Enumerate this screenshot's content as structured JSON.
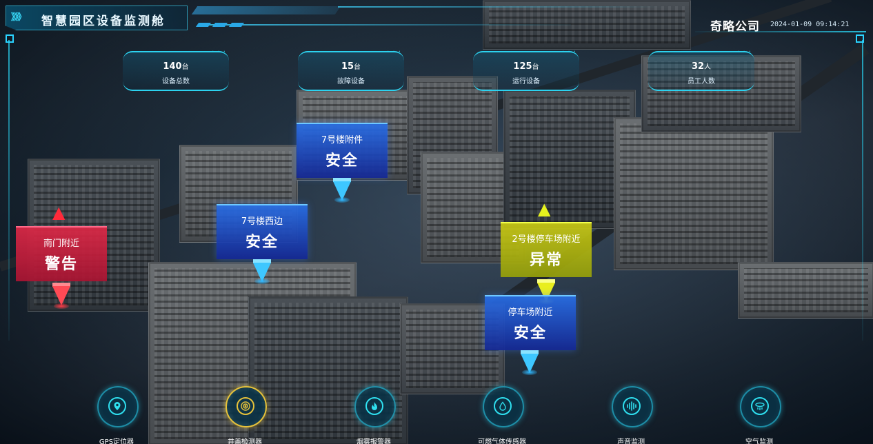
{
  "header": {
    "title_arrows": "》》》",
    "title": "智慧园区设备监测舱",
    "company": "奇略公司",
    "datetime": "2024-01-09 09:14:21"
  },
  "stats": [
    {
      "value": "140",
      "unit": "台",
      "label": "设备总数"
    },
    {
      "value": "15",
      "unit": "台",
      "label": "故障设备"
    },
    {
      "value": "125",
      "unit": "台",
      "label": "运行设备"
    },
    {
      "value": "32",
      "unit": "人",
      "label": "员工人数"
    }
  ],
  "stat_dots": "· · ·",
  "markers": [
    {
      "location": "南门附近",
      "status": "警告",
      "level": "warning",
      "color": "#e0284a"
    },
    {
      "location": "7号楼西边",
      "status": "安全",
      "level": "safe",
      "color": "#1e4fd6"
    },
    {
      "location": "7号楼附件",
      "status": "安全",
      "level": "safe",
      "color": "#1e4fd6"
    },
    {
      "location": "2号楼停车场附近",
      "status": "异常",
      "level": "abnormal",
      "color": "#c5cc14"
    },
    {
      "location": "停车场附近",
      "status": "安全",
      "level": "safe",
      "color": "#1e4fd6"
    }
  ],
  "tools": [
    {
      "label": "GPS定位器",
      "icon": "location-pin-icon",
      "active": false
    },
    {
      "label": "井盖检测器",
      "icon": "manhole-target-icon",
      "active": true
    },
    {
      "label": "烟雾报警器",
      "icon": "flame-icon",
      "active": false
    },
    {
      "label": "可燃气体传感器",
      "icon": "gas-drop-icon",
      "active": false
    },
    {
      "label": "声音监测",
      "icon": "sound-wave-icon",
      "active": false
    },
    {
      "label": "空气监测",
      "icon": "air-sensor-icon",
      "active": false
    }
  ],
  "colors": {
    "accent": "#2cd2ef",
    "safe": "#1e4fd6",
    "warning": "#e0284a",
    "abnormal": "#c5cc14",
    "active_tool": "#e6c23a"
  }
}
